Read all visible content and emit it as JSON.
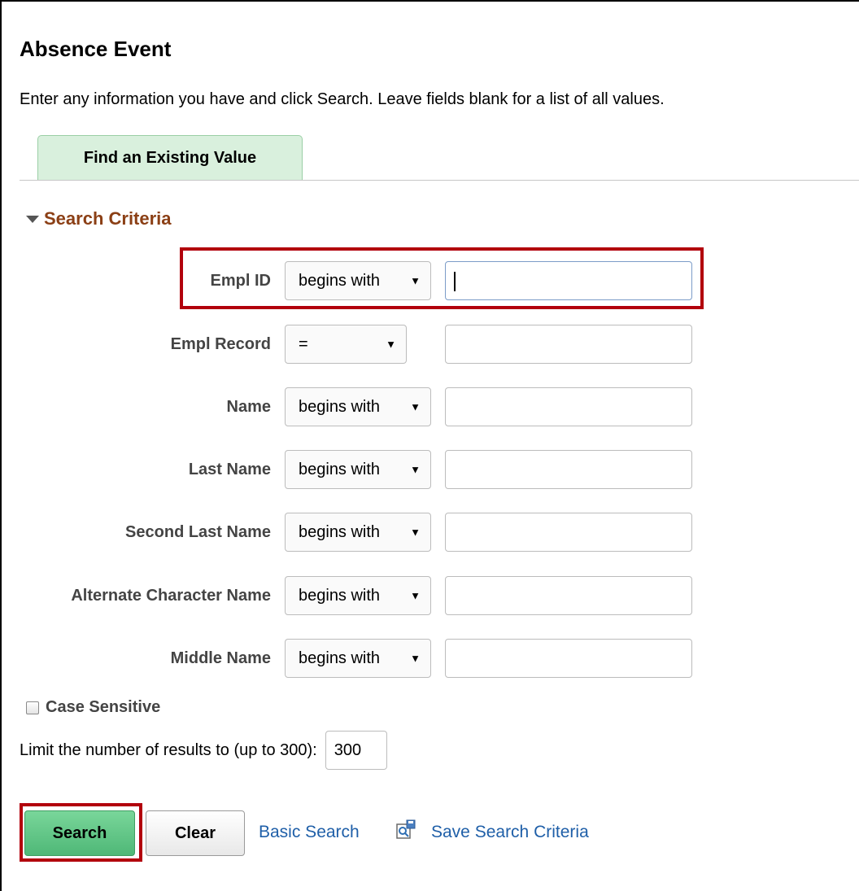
{
  "page": {
    "title": "Absence Event",
    "instructions": "Enter any information you have and click Search. Leave fields blank for a list of all values."
  },
  "tabs": [
    {
      "label": "Find an Existing Value",
      "active": true
    }
  ],
  "search_criteria": {
    "header": "Search Criteria",
    "fields": [
      {
        "label": "Empl ID",
        "operator": "begins with",
        "value": "",
        "focused": true
      },
      {
        "label": "Empl Record",
        "operator": "=",
        "value": ""
      },
      {
        "label": "Name",
        "operator": "begins with",
        "value": ""
      },
      {
        "label": "Last Name",
        "operator": "begins with",
        "value": ""
      },
      {
        "label": "Second Last Name",
        "operator": "begins with",
        "value": ""
      },
      {
        "label": "Alternate Character Name",
        "operator": "begins with",
        "value": ""
      },
      {
        "label": "Middle Name",
        "operator": "begins with",
        "value": ""
      }
    ],
    "case_sensitive": {
      "label": "Case Sensitive",
      "checked": false
    },
    "limit": {
      "label": "Limit the number of results to (up to 300):",
      "value": "300"
    }
  },
  "actions": {
    "search_label": "Search",
    "clear_label": "Clear",
    "basic_search_label": "Basic Search",
    "save_search_label": "Save Search Criteria"
  },
  "icons": {
    "dropdown": "dropdown-arrow-icon",
    "collapse": "collapse-triangle-icon",
    "save_search": "save-search-icon"
  },
  "colors": {
    "section_header": "#8b3f15",
    "link": "#1f5fa8",
    "search_button": "#4fb877",
    "tab_background": "#d9f0dd",
    "annotation_highlight": "#b2000c"
  }
}
